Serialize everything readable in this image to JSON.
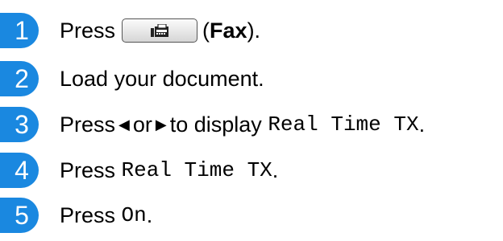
{
  "steps": [
    {
      "number": "1",
      "parts": [
        "Press",
        "(",
        "Fax",
        ")."
      ],
      "icon": "fax-icon"
    },
    {
      "number": "2",
      "text": "Load your document."
    },
    {
      "number": "3",
      "parts": [
        "Press",
        "or",
        "to display",
        "Real Time TX",
        "."
      ],
      "icons": [
        "left-arrow-icon",
        "right-arrow-icon"
      ]
    },
    {
      "number": "4",
      "parts": [
        "Press",
        "Real Time TX",
        "."
      ]
    },
    {
      "number": "5",
      "parts": [
        "Press",
        "On",
        "."
      ]
    }
  ],
  "colors": {
    "badge": "#1a88e0",
    "text": "#000000"
  }
}
